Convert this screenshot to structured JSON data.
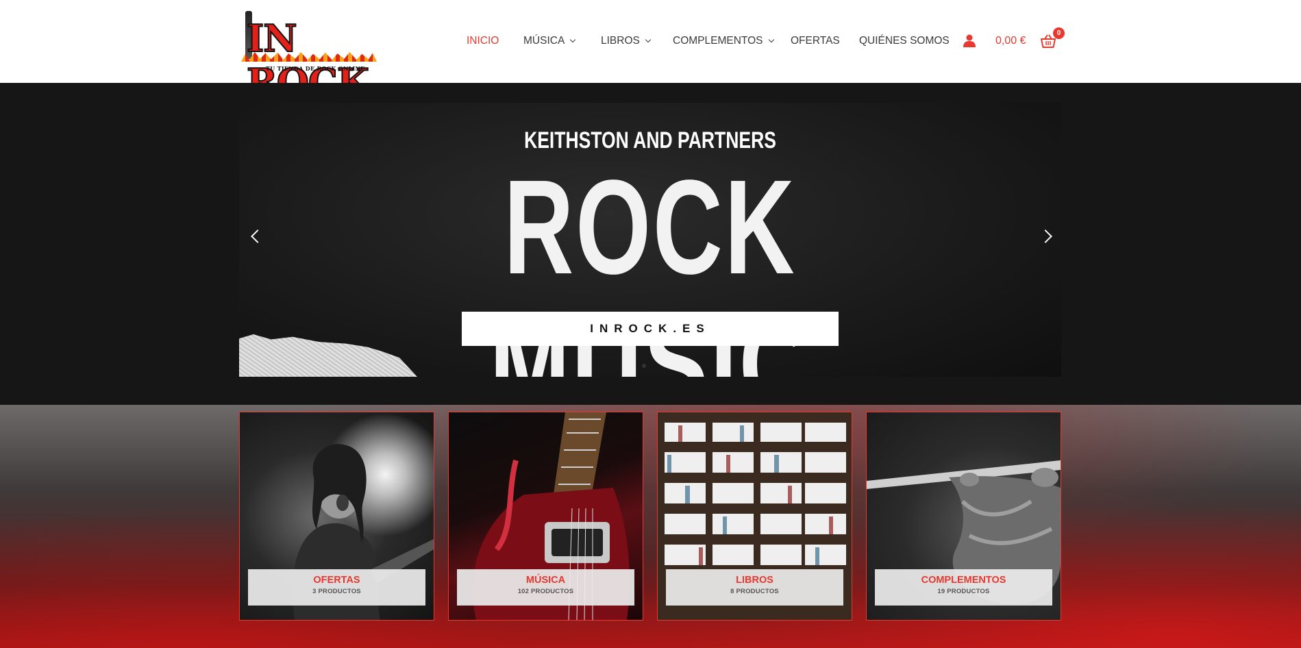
{
  "brand": {
    "logo_text": "IN ROCK",
    "tagline": "TU TIENDA DE ROCK ONLINE"
  },
  "nav": {
    "items": [
      {
        "label": "INICIO",
        "active": true,
        "has_dropdown": false
      },
      {
        "label": "MÚSICA",
        "active": false,
        "has_dropdown": true
      },
      {
        "label": "LIBROS",
        "active": false,
        "has_dropdown": true
      },
      {
        "label": "COMPLEMENTOS",
        "active": false,
        "has_dropdown": true
      },
      {
        "label": "OFERTAS",
        "active": false,
        "has_dropdown": false
      },
      {
        "label": "QUIÉNES SOMOS",
        "active": false,
        "has_dropdown": false
      }
    ],
    "account_icon": "user-icon",
    "cart_total": "0,00 €",
    "cart_icon": "basket-icon",
    "cart_count": "0"
  },
  "hero": {
    "subtitle": "KEITHSTON AND PARTNERS",
    "title": "ROCK MUSIC",
    "button_label": "INROCK.ES",
    "prev_icon": "chevron-left-icon",
    "next_icon": "chevron-right-icon"
  },
  "categories": [
    {
      "title": "OFERTAS",
      "count": "3 PRODUCTOS"
    },
    {
      "title": "MÚSICA",
      "count": "102 PRODUCTOS"
    },
    {
      "title": "LIBROS",
      "count": "8 PRODUCTOS"
    },
    {
      "title": "COMPLEMENTOS",
      "count": "19 PRODUCTOS"
    }
  ],
  "colors": {
    "accent": "#e8382f",
    "nav_text": "#3a3a3a",
    "hero_bg": "#161616"
  }
}
